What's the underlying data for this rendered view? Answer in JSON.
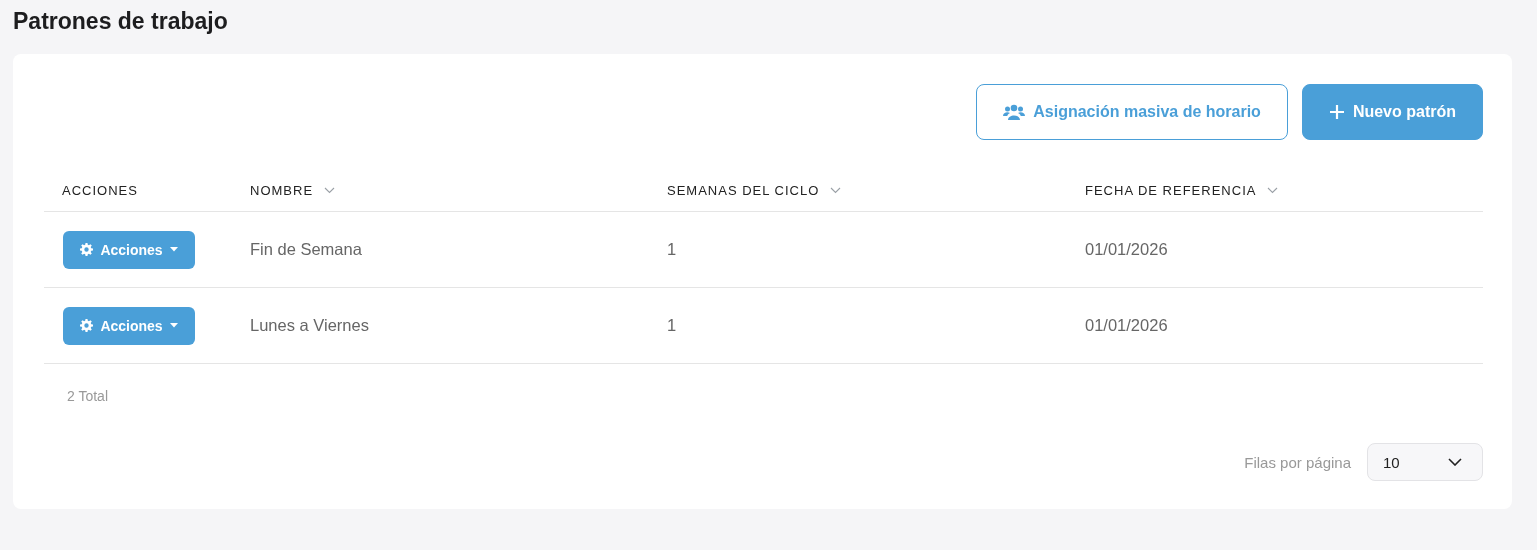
{
  "page": {
    "title": "Patrones de trabajo"
  },
  "toolbar": {
    "buttons": [
      {
        "kind": "outline",
        "label": "Asignación masiva de horario"
      },
      {
        "kind": "primary",
        "label": "Nuevo patrón"
      }
    ]
  },
  "table": {
    "columns": [
      {
        "label": "ACCIONES",
        "sortable": false
      },
      {
        "label": "NOMBRE",
        "sortable": true
      },
      {
        "label": "SEMANAS DEL CICLO",
        "sortable": true
      },
      {
        "label": "FECHA DE REFERENCIA",
        "sortable": true
      }
    ],
    "rows": [
      {
        "cells": [
          "Acciones",
          "Fin de Semana",
          "1",
          "01/01/2026"
        ]
      },
      {
        "cells": [
          "Acciones",
          "Lunes a Viernes",
          "1",
          "01/01/2026"
        ]
      }
    ]
  },
  "footer": {
    "total": "2 Total",
    "rows_per_page_label": "Filas por página",
    "rows_per_page": "10"
  }
}
